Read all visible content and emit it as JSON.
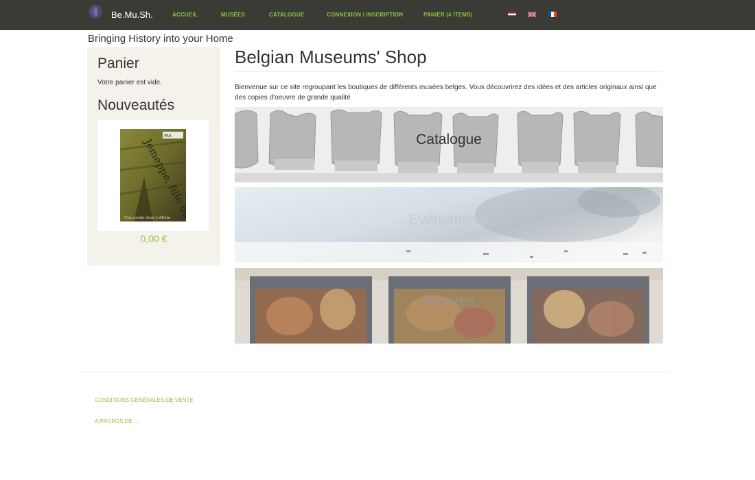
{
  "header": {
    "brand": "Be.Mu.Sh.",
    "nav": [
      {
        "label": "ACCUEIL"
      },
      {
        "label": "MUSÉES"
      },
      {
        "label": "CATALOGUE"
      },
      {
        "label": "CONNEXION / INSCRIPTION"
      },
      {
        "label": "PANIER (# ITEMS)"
      }
    ],
    "languages": [
      "nl",
      "en",
      "fr"
    ]
  },
  "tagline": "Bringing History into your Home",
  "sidebar": {
    "cart_title": "Panier",
    "cart_empty": "Votre panier est vide.",
    "new_title": "Nouveautés",
    "product": {
      "poster_title": "Jemeppe, fille du rail",
      "poster_credit": "Une production L'Altète",
      "price": "0,00 €"
    }
  },
  "main": {
    "title": "Belgian Museums' Shop",
    "intro": "Bienvenue sur ce site regroupant les boutiques de différents musées belges. Vous découvrirez des idées et des articles originaux ainsi que des copies d'oeuvre de grande qualité",
    "tiles": [
      {
        "label": "Catalogue"
      },
      {
        "label": "Evénements"
      },
      {
        "label": "Musées"
      }
    ]
  },
  "footer": {
    "links": [
      {
        "label": "CONDITIONS GÉNÉRALES DE VENTE"
      },
      {
        "label": "A PROPOS DE ..."
      }
    ]
  },
  "colors": {
    "navbar": "#3b3b36",
    "accent": "#8dc63f",
    "sidebar_bg": "#f5f1eb"
  }
}
